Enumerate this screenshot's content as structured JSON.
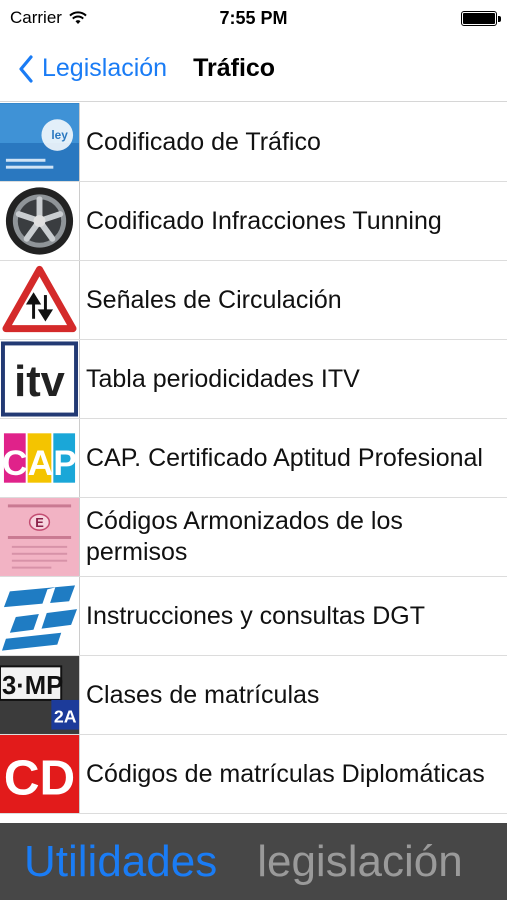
{
  "status_bar": {
    "carrier": "Carrier",
    "time": "7:55 PM"
  },
  "nav": {
    "back_label": "Legislación",
    "title": "Tráfico"
  },
  "thumbs": {
    "cap_text": "CAP",
    "itv_text": "itv",
    "plate_text_1": "3·MP",
    "plate_text_2": "2A",
    "cd_text": "CD",
    "ley_text": "ley",
    "permiso_letter": "E"
  },
  "items": [
    {
      "label": "Codificado de Tráfico",
      "icon": "ley-book-icon"
    },
    {
      "label": "Codificado Infracciones Tunning",
      "icon": "alloy-wheel-icon"
    },
    {
      "label": "Señales de Circulación",
      "icon": "warning-sign-icon"
    },
    {
      "label": "Tabla periodicidades ITV",
      "icon": "itv-logo-icon"
    },
    {
      "label": "CAP. Certificado Aptitud Profesional",
      "icon": "cap-logo-icon"
    },
    {
      "label": "Códigos Armonizados de los permisos",
      "icon": "driving-permit-icon"
    },
    {
      "label": "Instrucciones y consultas DGT",
      "icon": "dgt-logo-icon"
    },
    {
      "label": "Clases de matrículas",
      "icon": "license-plate-icon"
    },
    {
      "label": "Códigos de matrículas Diplomáticas",
      "icon": "cd-plate-icon"
    }
  ],
  "tabs": [
    {
      "label": "Utilidades",
      "active": true
    },
    {
      "label": "legislación",
      "active": false
    }
  ],
  "colors": {
    "accent": "#1a7cf5",
    "tabbar": "#474747"
  }
}
